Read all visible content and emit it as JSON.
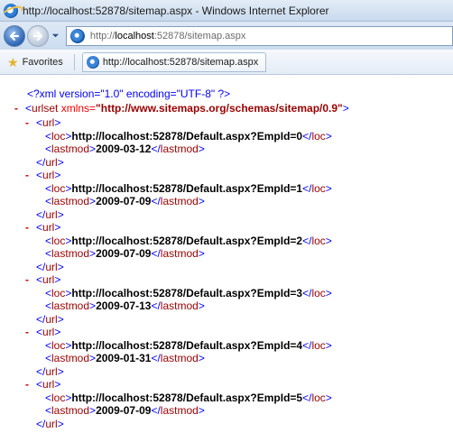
{
  "window": {
    "title": "http://localhost:52878/sitemap.aspx - Windows Internet Explorer"
  },
  "nav": {
    "address_prefix": "http://",
    "address_host": "localhost",
    "address_rest": ":52878/sitemap.aspx"
  },
  "favbar": {
    "favorites_label": "Favorites",
    "tab_label": "http://localhost:52878/sitemap.aspx"
  },
  "xml": {
    "declaration": "<?xml version=\"1.0\" encoding=\"UTF-8\" ?>",
    "expander": "-",
    "urlset_open_lt": "<",
    "urlset_tag": "urlset",
    "urlset_attr_name": " xmlns=",
    "urlset_attr_value": "\"http://www.sitemaps.org/schemas/sitemap/0.9\"",
    "urlset_open_gt": ">",
    "urls": [
      {
        "loc": "http://localhost:52878/Default.aspx?EmpId=0",
        "lastmod": "2009-03-12"
      },
      {
        "loc": "http://localhost:52878/Default.aspx?EmpId=1",
        "lastmod": "2009-07-09"
      },
      {
        "loc": "http://localhost:52878/Default.aspx?EmpId=2",
        "lastmod": "2009-07-09"
      },
      {
        "loc": "http://localhost:52878/Default.aspx?EmpId=3",
        "lastmod": "2009-07-13"
      },
      {
        "loc": "http://localhost:52878/Default.aspx?EmpId=4",
        "lastmod": "2009-01-31"
      },
      {
        "loc": "http://localhost:52878/Default.aspx?EmpId=5",
        "lastmod": "2009-07-09"
      }
    ]
  }
}
